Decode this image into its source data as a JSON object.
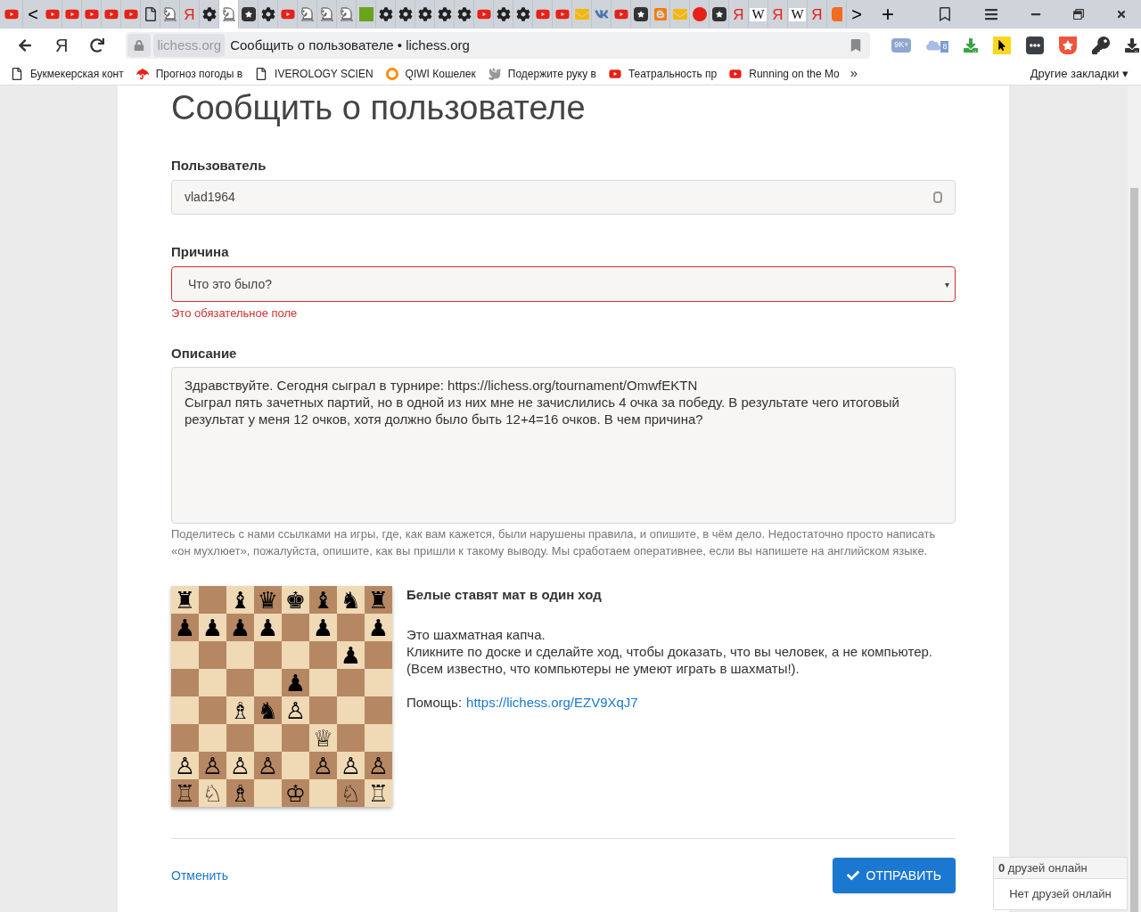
{
  "tab_strip": {
    "scroll_left": "<",
    "scroll_right": ">",
    "new_tab": "+",
    "tabs": [
      {
        "kind": "video",
        "selected": false
      },
      {
        "kind": "video",
        "selected": false
      },
      {
        "kind": "video",
        "selected": false
      },
      {
        "kind": "video",
        "selected": false
      },
      {
        "kind": "video",
        "selected": false
      },
      {
        "kind": "video",
        "selected": false
      },
      {
        "kind": "page",
        "selected": false
      },
      {
        "kind": "knight",
        "selected": false
      },
      {
        "kind": "letter",
        "glyph": "Я",
        "selected": false
      },
      {
        "kind": "gear",
        "selected": false
      },
      {
        "kind": "knight",
        "selected": true
      },
      {
        "kind": "sparkle",
        "selected": false
      },
      {
        "kind": "gear",
        "selected": false
      },
      {
        "kind": "video",
        "selected": false
      },
      {
        "kind": "knight",
        "selected": false
      },
      {
        "kind": "knight",
        "selected": false
      },
      {
        "kind": "knight",
        "selected": false
      },
      {
        "kind": "green",
        "selected": false
      },
      {
        "kind": "gear",
        "selected": false
      },
      {
        "kind": "gear",
        "selected": false
      },
      {
        "kind": "gear",
        "selected": false
      },
      {
        "kind": "gear",
        "selected": false
      },
      {
        "kind": "gear",
        "selected": false
      },
      {
        "kind": "video",
        "selected": false
      },
      {
        "kind": "gear",
        "selected": false
      },
      {
        "kind": "gear",
        "selected": false
      },
      {
        "kind": "video",
        "selected": false
      },
      {
        "kind": "video",
        "selected": false
      },
      {
        "kind": "mail",
        "selected": false
      },
      {
        "kind": "vk",
        "selected": false
      },
      {
        "kind": "video",
        "selected": false
      },
      {
        "kind": "sparkle",
        "selected": false
      },
      {
        "kind": "blog",
        "selected": false
      },
      {
        "kind": "mail",
        "selected": false
      },
      {
        "kind": "badge",
        "selected": false
      },
      {
        "kind": "sparkle",
        "selected": false
      },
      {
        "kind": "letter",
        "glyph": "Я",
        "selected": false
      },
      {
        "kind": "wiki",
        "glyph": "W",
        "selected": false
      },
      {
        "kind": "letter",
        "glyph": "Я",
        "selected": false
      },
      {
        "kind": "wiki",
        "glyph": "W",
        "selected": false
      },
      {
        "kind": "letter",
        "glyph": "Я",
        "selected": false
      },
      {
        "kind": "orange",
        "selected": false
      }
    ]
  },
  "address_bar": {
    "browser_logo": "Я",
    "domain": "lichess.org",
    "title": "Сообщить о пользователе • lichess.org",
    "counters": [
      "9K+",
      "8"
    ]
  },
  "bookmarks": {
    "items": [
      {
        "kind": "page",
        "label": "Букмекерская конт"
      },
      {
        "kind": "umbrella",
        "label": "Прогноз погоды в"
      },
      {
        "kind": "page",
        "label": "IVEROLOGY SCIEN"
      },
      {
        "kind": "qiwi",
        "label": "QIWI Кошелек"
      },
      {
        "kind": "bird",
        "label": "Подержите руку в"
      },
      {
        "kind": "video",
        "label": "Театральность пр"
      },
      {
        "kind": "video",
        "label": "Running on the Mo"
      }
    ],
    "more": "»",
    "other": "Другие закладки",
    "other_caret": "▾"
  },
  "page": {
    "heading": "Сообщить о пользователе",
    "user_field": {
      "label": "Пользователь",
      "value": "vlad1964"
    },
    "reason_field": {
      "label": "Причина",
      "value": "Что это было?",
      "caret": "▾",
      "invalid": true,
      "error": "Это обязательное поле"
    },
    "description_field": {
      "label": "Описание",
      "lines": [
        "Здравствуйте. Сегодня сыграл в турнире: https://lichess.org/tournament/OmwfEKTN",
        "Сыграл пять зачетных партий, но в одной из них мне не зачислились 4 очка за победу. В результате чего итоговый результат у меня 12 очков, хотя должно было быть 12+4=16 очков. В чем причина?"
      ],
      "help": "Поделитесь с нами ссылками на игры, где, как вам кажется, были нарушены правила, и опишите, в чём дело. Недостаточно просто написать «он мухлюет», пожалуйста, опишите, как вы пришли к такому выводу. Мы сработаем оперативнее, если вы напишете на английском языке."
    },
    "captcha": {
      "board": [
        "♜ ♝♛♚♝♞♜",
        "♟♟♟♟ ♟ ♟",
        "      ♟ ",
        "    ♟   ",
        "  ♗♞♙   ",
        "     ♕  ",
        "♙♙♙♙ ♙♙♙",
        "♖♘♗ ♔ ♘♖"
      ],
      "title": "Белые ставят мат в один ход",
      "lines": [
        "Это шахматная капча.",
        "Кликните по доске и сделайте ход, чтобы доказать, что вы человек, а не компьютер.",
        "(Всем известно, что компьютеры не умеют играть в шахматы!)."
      ],
      "help_label": "Помощь:",
      "help_link": "https://lichess.org/EZV9XqJ7"
    },
    "cancel": "Отменить",
    "submit": "ОТПРАВИТЬ"
  },
  "friends": {
    "count": "0",
    "count_label": "друзей онлайн",
    "empty": "Нет друзей онлайн"
  }
}
